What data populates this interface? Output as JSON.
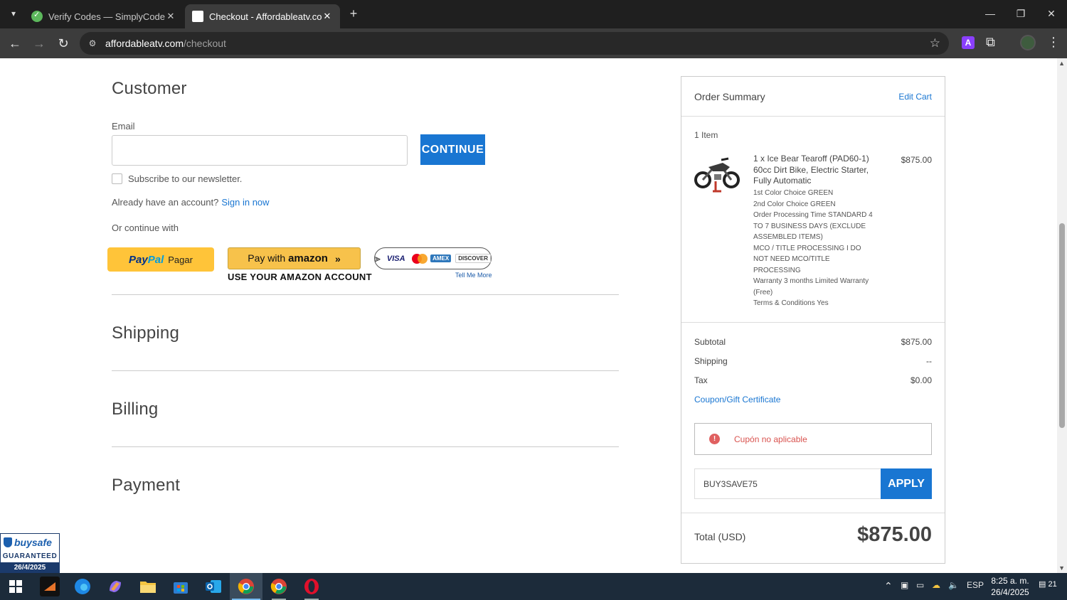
{
  "browser": {
    "tabs": [
      {
        "title": "Verify Codes — SimplyCodes",
        "active": false
      },
      {
        "title": "Checkout - Affordableatv.com",
        "active": true
      }
    ],
    "url_host": "affordableatv.com",
    "url_path": "/checkout"
  },
  "customer": {
    "title": "Customer",
    "email_label": "Email",
    "email_value": "",
    "continue_label": "CONTINUE",
    "newsletter_label": "Subscribe to our newsletter.",
    "have_account": "Already have an account?",
    "sign_in": "Sign in now",
    "or_continue": "Or continue with",
    "paypal_pay": "Pay",
    "paypal_pal": "Pal",
    "paypal_word": "Pagar",
    "amazon_prefix": "Pay with",
    "amazon_brand": "amazon",
    "amazon_sub": "USE YOUR AMAZON ACCOUNT",
    "cards": {
      "visa": "VISA",
      "amex": "AMEX",
      "discover": "DISCOVER"
    },
    "tell_more": "Tell Me More"
  },
  "sections": {
    "shipping": "Shipping",
    "billing": "Billing",
    "payment": "Payment"
  },
  "summary": {
    "title": "Order Summary",
    "edit_cart": "Edit Cart",
    "item_count": "1 Item",
    "product": {
      "name": "1 x Ice Bear Tearoff (PAD60-1) 60cc Dirt Bike, Electric Starter, Fully Automatic",
      "options": [
        "1st Color Choice GREEN",
        "2nd Color Choice GREEN",
        "Order Processing Time STANDARD 4 TO 7 BUSINESS DAYS (EXCLUDE ASSEMBLED ITEMS)",
        "MCO / TITLE PROCESSING I DO NOT NEED MCO/TITLE PROCESSING",
        "Warranty 3 months Limited Warranty (Free)",
        "Terms & Conditions Yes"
      ],
      "price": "$875.00"
    },
    "subtotal_label": "Subtotal",
    "subtotal_value": "$875.00",
    "shipping_label": "Shipping",
    "shipping_value": "--",
    "tax_label": "Tax",
    "tax_value": "$0.00",
    "coupon_link": "Coupon/Gift Certificate",
    "alert_text": "Cupón no aplicable",
    "coupon_value": "BUY3SAVE75",
    "apply_label": "APPLY",
    "total_label": "Total (USD)",
    "total_value": "$875.00"
  },
  "buysafe": {
    "name": "buysafe",
    "guaranteed": "GUARANTEED",
    "date": "26/4/2025"
  },
  "taskbar": {
    "lang": "ESP",
    "time": "8:25 a. m.",
    "date": "26/4/2025",
    "notifications": "21"
  },
  "colors": {
    "accent": "#1976d2",
    "paypal": "#ffc439",
    "amazon": "#f7c24b",
    "alert": "#d9534f"
  }
}
